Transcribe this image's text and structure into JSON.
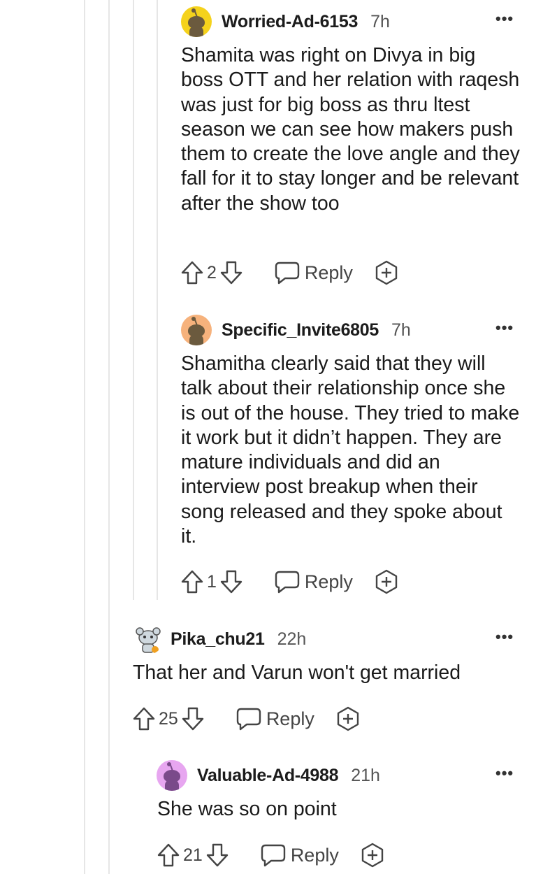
{
  "comments": [
    {
      "username": "Worried-Ad-6153",
      "time": "7h",
      "avatar_color": "#f5d21c",
      "body": "Shamita was right on Divya in big boss OTT and her relation with raqesh was just for big boss as thru ltest season we can see how makers push them to create the love angle and they fall for it to stay longer and be relevant after the show too",
      "votes": "2",
      "reply_label": "Reply",
      "more_label": "•••"
    },
    {
      "username": "Specific_Invite6805",
      "time": "7h",
      "avatar_color": "#f6b27c",
      "body": "Shamitha clearly said that they will talk about their relationship once she is out of the house. They tried to make it work but it didn’t happen. They are mature individuals and did an interview post breakup when their song released and they spoke about it.",
      "votes": "1",
      "reply_label": "Reply",
      "more_label": "•••"
    },
    {
      "username": "Pika_chu21",
      "time": "22h",
      "avatar_color": "#ffffff",
      "body": "That her and Varun won't get married",
      "votes": "25",
      "reply_label": "Reply",
      "more_label": "•••"
    },
    {
      "username": "Valuable-Ad-4988",
      "time": "21h",
      "avatar_color": "#e7a6f0",
      "body": "She was so on point",
      "votes": "21",
      "reply_label": "Reply",
      "more_label": "•••"
    }
  ],
  "icons": [
    "upvote-icon",
    "downvote-icon",
    "reply-icon",
    "award-icon",
    "more-icon",
    "avatar-icon"
  ]
}
